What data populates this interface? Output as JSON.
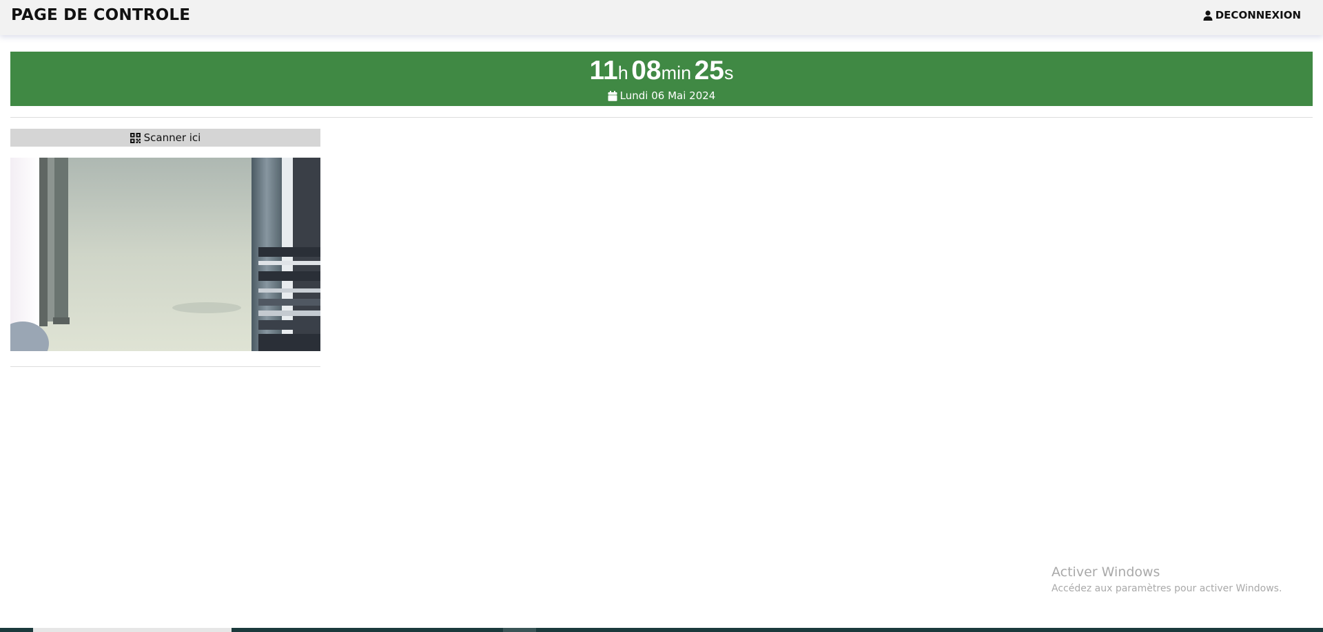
{
  "header": {
    "title": "PAGE DE CONTROLE",
    "logout_label": "DECONNEXION",
    "logout_icon": "user-icon"
  },
  "clock": {
    "hours": "11",
    "hours_unit": "h",
    "minutes": "08",
    "minutes_unit": "min",
    "seconds": "25",
    "seconds_unit": "s",
    "date": "Lundi 06 Mai 2024",
    "date_icon": "calendar-icon",
    "background_color": "#408944"
  },
  "scanner": {
    "button_label": "Scanner ici",
    "button_icon": "qrcode-icon"
  },
  "watermark": {
    "title": "Activer Windows",
    "subtitle": "Accédez aux paramètres pour activer Windows."
  }
}
